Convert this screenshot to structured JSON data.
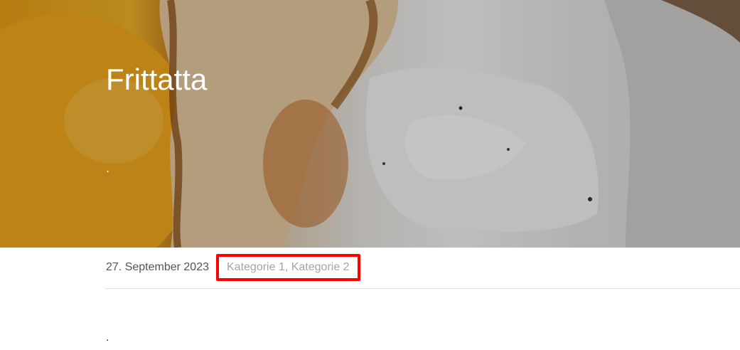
{
  "post": {
    "title": "Frittatta",
    "subtitle": ".",
    "date": "27. September 2023",
    "categories": "Kategorie 1, Kategorie 2",
    "content": "."
  },
  "colors": {
    "title_text": "#ffffff",
    "date_text": "#555555",
    "categories_text": "#a4a4a4",
    "highlight_border": "#ff0000",
    "divider": "#dcdcdc"
  },
  "hero_image": "fried-egg-photo"
}
